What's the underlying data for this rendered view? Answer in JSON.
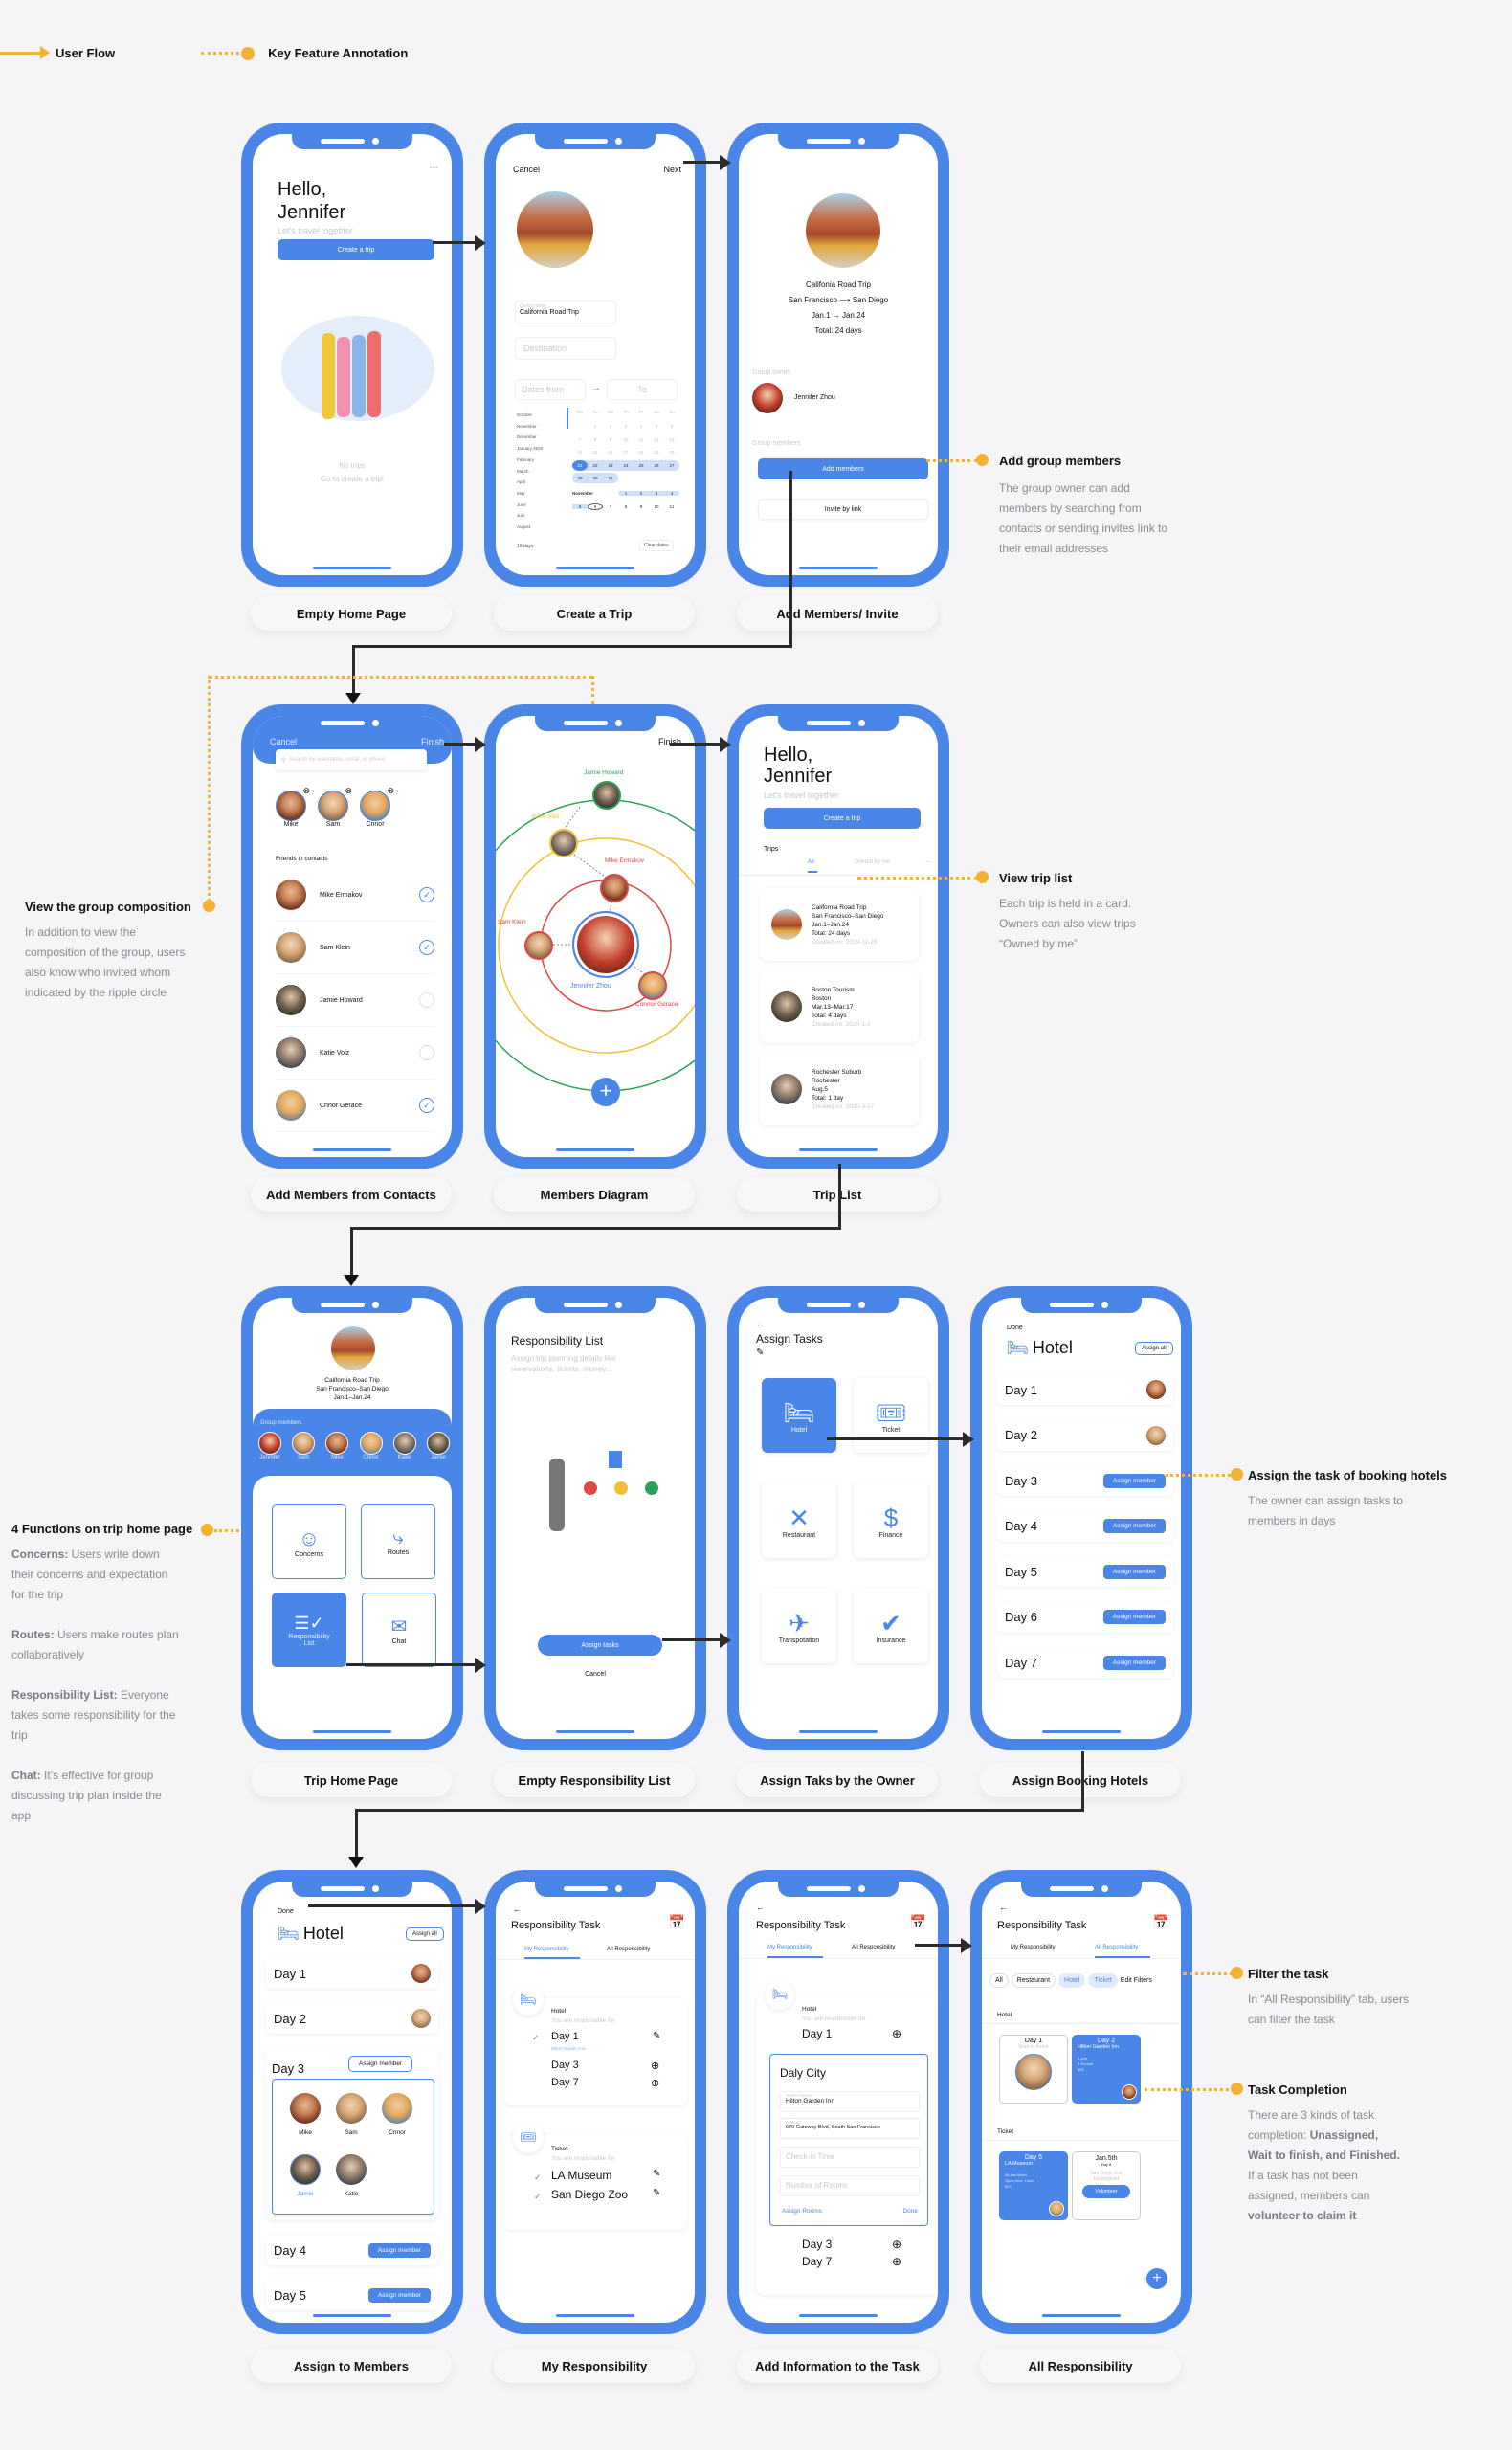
{
  "legend": {
    "user_flow": "User Flow",
    "key_feature": "Key Feature Annotation"
  },
  "colors": {
    "brand": "#4a86e8",
    "annotation": "#f2b233",
    "background": "#f5f4f7"
  },
  "captions": [
    "Empty Home Page",
    "Create a Trip",
    "Add Members/ Invite",
    "Add Members from Contacts",
    "Members Diagram",
    "Trip List",
    "Trip Home Page",
    "Empty Responsibility List",
    "Assign Taks by the Owner",
    "Assign Booking Hotels",
    "Assign to Members",
    "My Responsibility",
    "Add Information to the Task",
    "All Responsibility"
  ],
  "annotations": {
    "add_group": {
      "title": "Add group members",
      "text": "The group owner can add members by searching from contacts or sending invites link to their email addresses"
    },
    "group_comp": {
      "title": "View the group composition",
      "text": "In addition to view the composition of the group, users also know who invited whom indicated by the ripple circle"
    },
    "trip_list": {
      "title": "View trip list",
      "text": "Each trip is held in a card. Owners can also view trips “Owned by me”"
    },
    "four_functions": {
      "title": "4 Functions on trip home page",
      "items": [
        {
          "label": "Concerns:",
          "text": "Users write down their concerns and expectation for the trip"
        },
        {
          "label": "Routes:",
          "text": "Users make routes plan collaboratively"
        },
        {
          "label": "Responsibility List:",
          "text": "Everyone takes some responsibility for the trip"
        },
        {
          "label": "Chat:",
          "text": "It’s effective for group discussing trip plan inside the app"
        }
      ]
    },
    "assign_hotels": {
      "title": "Assign the task of booking hotels",
      "text": "The owner can assign tasks to members in days"
    },
    "filter": {
      "title": "Filter the task",
      "text": "In “All Responsibility” tab, users can filter the task"
    },
    "completion": {
      "title": "Task Completion",
      "text1": "There are 3 kinds of task completion:",
      "bold1": "Unassigned, Wait to finish, and Finished.",
      "text2": "If a task has not been assigned, members can",
      "bold2": "volunteer to claim it"
    }
  },
  "home_empty": {
    "greeting": "Hello,",
    "name": "Jennifer",
    "subtitle": "Let's travel together",
    "create_btn": "Create a trip",
    "empty1": "No trips",
    "empty2": "Go to create a trip!",
    "menu": "•••"
  },
  "create_trip": {
    "cancel": "Cancel",
    "next": "Next",
    "group_label": "Group name",
    "group_value": "California Road Trip",
    "destination_ph": "Destination",
    "dates_from_ph": "Dates from",
    "to_ph": "To",
    "months": [
      "October",
      "November",
      "December",
      "January 2020",
      "February",
      "March",
      "April",
      "May",
      "June",
      "Julo",
      "August"
    ],
    "weekdays": [
      "Mo",
      "Tu",
      "We",
      "Th",
      "Fr",
      "Sa",
      "Su"
    ],
    "week1": [
      "",
      "1",
      "2",
      "3",
      "4",
      "5",
      "6"
    ],
    "week2": [
      "7",
      "8",
      "9",
      "10",
      "11",
      "12",
      "13"
    ],
    "week3": [
      "14",
      "15",
      "16",
      "17",
      "18",
      "19",
      "20"
    ],
    "week4": [
      "21",
      "22",
      "23",
      "24",
      "25",
      "26",
      "27"
    ],
    "week5": [
      "29",
      "30",
      "31",
      "",
      "",
      "",
      ""
    ],
    "nov_label": "November",
    "nov1": [
      "1",
      "2",
      "3",
      "4"
    ],
    "nov2": [
      "5",
      "6",
      "7",
      "8",
      "9",
      "10",
      "11"
    ],
    "days_count": "16 days",
    "clear": "Clear dates"
  },
  "add_members": {
    "trip_name": "Califonia Road Trip",
    "route_from": "San Francisco",
    "route_to": "San Diego",
    "dates": "Jan.1 → Jan.24",
    "total": "Total: 24 days",
    "owner_label": "Group owner",
    "owner_name": "Jennifer Zhou",
    "members_label": "Group members",
    "add_btn": "Add members",
    "invite_btn": "Invite by link"
  },
  "contacts": {
    "cancel": "Cancel",
    "finish": "Finish",
    "search_ph": "Search by username, email, or phone",
    "selected": [
      "Mike",
      "Sam",
      "Cnnor"
    ],
    "section": "Friends in contacts",
    "list": [
      {
        "name": "Mike Ermakov",
        "checked": true
      },
      {
        "name": "Sam Klein",
        "checked": true
      },
      {
        "name": "Jamie Howard",
        "checked": false
      },
      {
        "name": "Katie Volz",
        "checked": false
      },
      {
        "name": "Cnnor Gerace",
        "checked": true
      }
    ]
  },
  "diagram": {
    "finish": "Finish",
    "center": "Jennifer Zhou",
    "nodes": [
      {
        "name": "Jamie Howard",
        "ring": "green"
      },
      {
        "name": "Katie Volz",
        "ring": "yellow"
      },
      {
        "name": "Mike Ermakov",
        "ring": "red"
      },
      {
        "name": "Sam Klein",
        "ring": "red"
      },
      {
        "name": "Connor Gerace",
        "ring": "red"
      }
    ],
    "ring_colors": {
      "green": "#2e9e5b",
      "yellow": "#f2c037",
      "red": "#e04545",
      "blue": "#4a86e8"
    }
  },
  "trip_list": {
    "greeting": "Hello,",
    "name": "Jennifer",
    "subtitle": "Let's travel together",
    "create_btn": "Create a trip",
    "section": "Trips",
    "tabs": [
      "All",
      "Owned by me",
      "—"
    ],
    "trips": [
      {
        "title": "California Road Trip",
        "place": "San Francisco–San Diego",
        "dates": "Jan.1–Jan.24",
        "total": "Total: 24 days",
        "created": "Created on: 2019-11-28"
      },
      {
        "title": "Boston Tourism",
        "place": "Boston",
        "dates": "Mar.13–Mar.17",
        "total": "Total: 4 days",
        "created": "Created on: 2020-1-2"
      },
      {
        "title": "Rochester Suburb",
        "place": "Rochester",
        "dates": "Aug.5",
        "total": "Total: 1 day",
        "created": "Created on: 2020-3-17"
      }
    ]
  },
  "trip_home": {
    "title": "California Road Trip",
    "route": "San Francisco–San Diego",
    "dates": "Jan.1–Jan.24",
    "members_label": "Group members",
    "members": [
      "Jennifer",
      "Sam",
      "Mike",
      "Cnnor",
      "Katie",
      "Jamie"
    ],
    "functions": [
      "Concerns",
      "Routes",
      "Responsibility List",
      "Chat"
    ]
  },
  "resp_empty": {
    "title": "Responsibility List",
    "subtitle": "Assign trip planning details like reservations, tickets, money...",
    "assign_btn": "Assign tasks",
    "cancel": "Cancel"
  },
  "assign_tasks": {
    "title": "Assign Tasks",
    "tiles": [
      "Hotel",
      "Ticket",
      "Restaurant",
      "Finance",
      "Transpotation",
      "Insurance"
    ]
  },
  "hotel_assign": {
    "done": "Done",
    "title": "Hotel",
    "assign_all": "Assign all",
    "assign_member": "Assign member",
    "days": [
      "Day 1",
      "Day 2",
      "Day 3",
      "Day 4",
      "Day 5",
      "Day 6",
      "Day 7"
    ]
  },
  "assign_members": {
    "done": "Done",
    "title": "Hotel",
    "assign_all": "Assign all",
    "assign_member": "Assign member",
    "days": [
      "Day 1",
      "Day 2",
      "Day 3",
      "Day 4",
      "Day 5"
    ],
    "picker": [
      "Mike",
      "Sam",
      "Cnnor",
      "Jamie",
      "Katie"
    ]
  },
  "my_resp": {
    "title": "Responsibility Task",
    "tabs": [
      "My Responsibility",
      "All Responsibility"
    ],
    "hotel": {
      "label": "Hotel",
      "sub": "You are responsible for",
      "items": [
        "Day 1",
        "Day 3",
        "Day 7"
      ],
      "note": "Hilton Garden Inn..."
    },
    "ticket": {
      "label": "Ticket",
      "sub": "You are responsible for",
      "items": [
        "LA Museum",
        "San Diego Zoo"
      ]
    }
  },
  "add_info": {
    "title": "Responsibility Task",
    "tabs": [
      "My Responsibility",
      "All Responsibility"
    ],
    "hotel_label": "Hotel",
    "sub": "You are responsible for",
    "day": "Day 1",
    "city": "Daly City",
    "hotel_name_label": "Hotel's Name",
    "hotel_name": "Hilton Garden Inn",
    "address_label": "Address",
    "address": "670 Gateway Blvd, South San Francisco",
    "checkin_ph": "Check-in Time",
    "rooms_ph": "Number of Rooms",
    "assign_rooms": "Assign Rooms",
    "done": "Done",
    "more_days": [
      "Day 3",
      "Day 7"
    ]
  },
  "all_resp": {
    "title": "Responsibility Task",
    "tabs": [
      "My Responsibility",
      "All Responsibility"
    ],
    "filters": [
      "All",
      "Restaurant",
      "Hotel",
      "Ticket"
    ],
    "edit_filters": "Edit Filters",
    "hotel_label": "Hotel",
    "ticket_label": "Ticket",
    "hotel_cards": [
      {
        "day": "Day 1",
        "status": "Wait to finish"
      },
      {
        "day": "Day 2",
        "name": "Hilton Garden Inn",
        "details": [
          "4-star",
          "3 Rooms",
          "$89"
        ]
      }
    ],
    "ticket_cards": [
      {
        "day": "Day 5",
        "name": "LA Museum",
        "details": [
          "All-day ticket",
          "Open time: 10am",
          "$20"
        ]
      },
      {
        "day": "Jan.5th",
        "sub": "Day 8",
        "name": "San Diego Zoo",
        "status": "Unassigned",
        "btn": "Volunteer"
      }
    ]
  }
}
